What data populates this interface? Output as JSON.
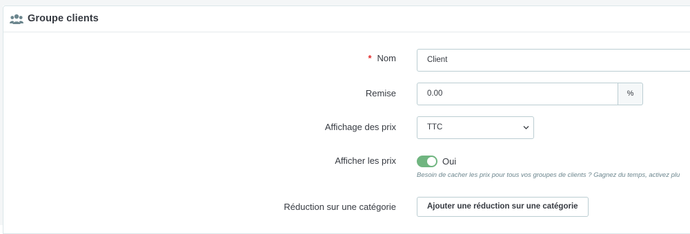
{
  "panel": {
    "title": "Groupe clients",
    "icon": "users-group-icon"
  },
  "form": {
    "name": {
      "required_marker": "*",
      "label": "Nom",
      "value": "Client"
    },
    "discount": {
      "label": "Remise",
      "value": "0.00",
      "unit": "%"
    },
    "price_display": {
      "label": "Affichage des prix",
      "selected": "TTC"
    },
    "show_prices": {
      "label": "Afficher les prix",
      "state_label": "Oui",
      "enabled": true,
      "help": "Besoin de cacher les prix pour tous vos groupes de clients ? Gagnez du temps, activez plu"
    },
    "category_reduction": {
      "label": "Réduction sur une catégorie",
      "button_label": "Ajouter une réduction sur une catégorie"
    }
  },
  "colors": {
    "toggle_on": "#70b580",
    "required": "#e22a2a"
  }
}
